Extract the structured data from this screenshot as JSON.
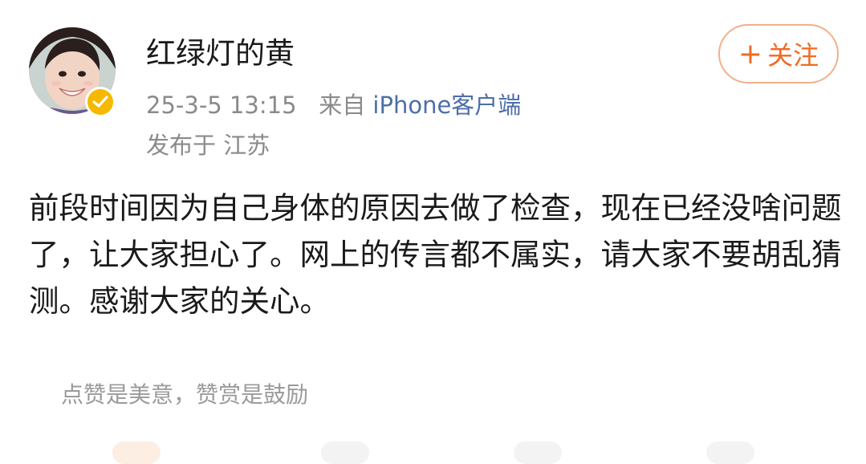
{
  "user": {
    "name": "红绿灯的黄",
    "avatar_icon": "user-avatar-photo",
    "verified_icon": "verified-badge-icon",
    "verified_color": "#f6b800"
  },
  "meta": {
    "datetime": "25-3-5 13:15",
    "source_prefix": "来自",
    "source_client": "iPhone客户端",
    "location": "发布于 江苏"
  },
  "follow_button": {
    "plus": "+",
    "label": "关注",
    "color": "#f06a24"
  },
  "post": {
    "text": "前段时间因为自己身体的原因去做了检查，现在已经没啥问题了，让大家担心了。网上的传言都不属实，请大家不要胡乱猜测。感谢大家的关心。"
  },
  "reward": {
    "hint": "点赞是美意，赞赏是鼓励"
  }
}
